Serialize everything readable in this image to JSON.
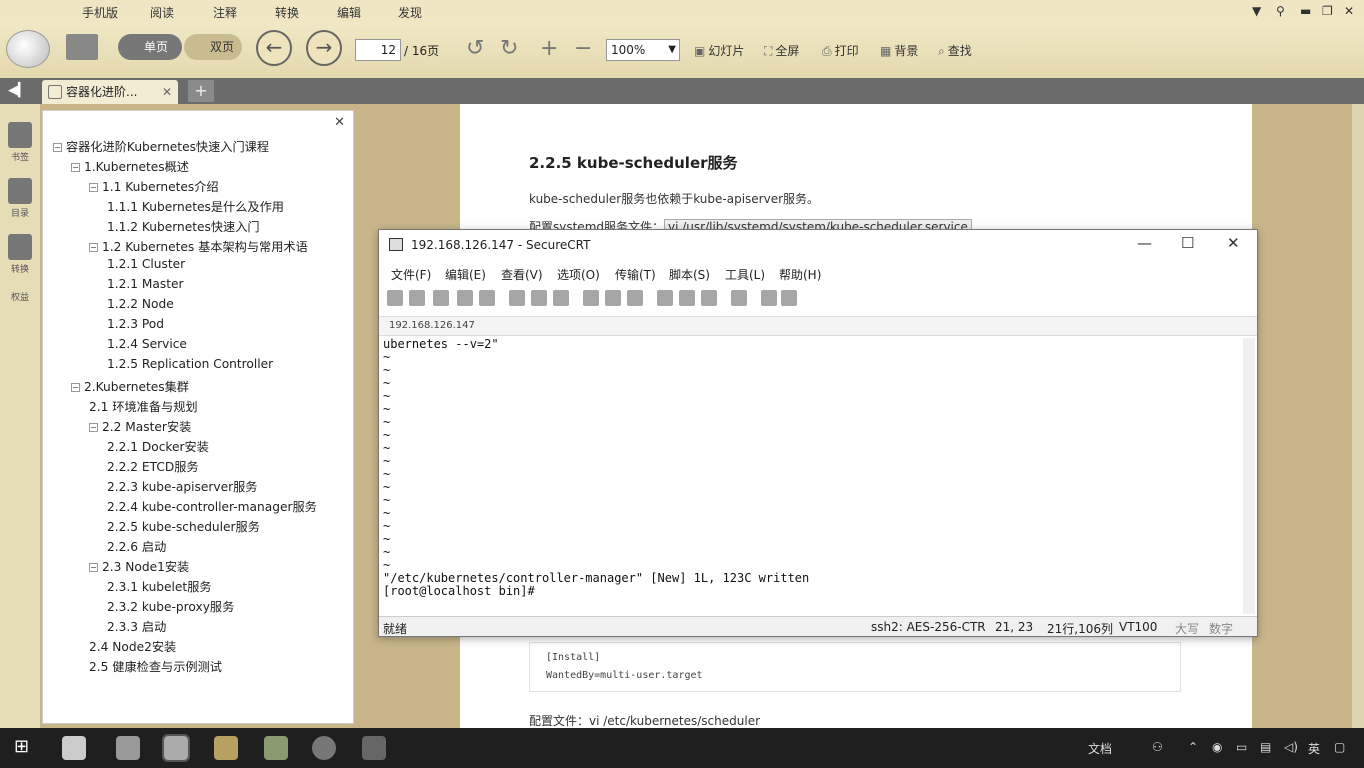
{
  "reader": {
    "menu": [
      "手机版",
      "阅读",
      "注释",
      "转换",
      "编辑",
      "发现"
    ],
    "view_single": "单页",
    "view_double": "双页",
    "page_current": "12",
    "page_total": "/ 16页",
    "zoom": "100%",
    "buttons": {
      "slideshow": "幻灯片",
      "fullscreen": "全屏",
      "print": "打印",
      "background": "背景",
      "find": "查找"
    },
    "tab_title": "容器化进阶...",
    "left_rail": {
      "bookmark": "书签",
      "toc": "目录",
      "convert": "转换",
      "more": "权益"
    }
  },
  "toc": [
    {
      "label": "容器化进阶Kubernetes快速入门课程",
      "level": 0,
      "toggle": "−"
    },
    {
      "label": "1.Kubernetes概述",
      "level": 1,
      "toggle": "−"
    },
    {
      "label": "1.1 Kubernetes介绍",
      "level": 2,
      "toggle": "−"
    },
    {
      "label": "1.1.1 Kubernetes是什么及作用",
      "level": 3,
      "toggle": ""
    },
    {
      "label": "1.1.2 Kubernetes快速入门",
      "level": 3,
      "toggle": ""
    },
    {
      "label": "1.2 Kubernetes 基本架构与常用术语",
      "level": 2,
      "toggle": "−"
    },
    {
      "label": "1.2.1 Cluster",
      "level": 3,
      "toggle": ""
    },
    {
      "label": "1.2.1 Master",
      "level": 3,
      "toggle": ""
    },
    {
      "label": "1.2.2 Node",
      "level": 3,
      "toggle": ""
    },
    {
      "label": "1.2.3 Pod",
      "level": 3,
      "toggle": ""
    },
    {
      "label": "1.2.4 Service",
      "level": 3,
      "toggle": ""
    },
    {
      "label": "1.2.5 Replication Controller",
      "level": 3,
      "toggle": ""
    },
    {
      "label": "2.Kubernetes集群",
      "level": 1,
      "toggle": "−"
    },
    {
      "label": "2.1 环境准备与规划",
      "level": 2,
      "toggle": ""
    },
    {
      "label": "2.2 Master安装",
      "level": 2,
      "toggle": "−"
    },
    {
      "label": "2.2.1 Docker安装",
      "level": 3,
      "toggle": ""
    },
    {
      "label": "2.2.2 ETCD服务",
      "level": 3,
      "toggle": ""
    },
    {
      "label": "2.2.3 kube-apiserver服务",
      "level": 3,
      "toggle": ""
    },
    {
      "label": "2.2.4 kube-controller-manager服务",
      "level": 3,
      "toggle": ""
    },
    {
      "label": "2.2.5 kube-scheduler服务",
      "level": 3,
      "toggle": ""
    },
    {
      "label": "2.2.6 启动",
      "level": 3,
      "toggle": ""
    },
    {
      "label": "2.3 Node1安装",
      "level": 2,
      "toggle": "−"
    },
    {
      "label": "2.3.1 kubelet服务",
      "level": 3,
      "toggle": ""
    },
    {
      "label": "2.3.2 kube-proxy服务",
      "level": 3,
      "toggle": ""
    },
    {
      "label": "2.3.3 启动",
      "level": 3,
      "toggle": ""
    },
    {
      "label": "2.4 Node2安装",
      "level": 2,
      "toggle": ""
    },
    {
      "label": "2.5 健康检查与示例测试",
      "level": 2,
      "toggle": ""
    }
  ],
  "document": {
    "heading": "2.2.5 kube-scheduler服务",
    "para1": "kube-scheduler服务也依赖于kube-apiserver服务。",
    "para2_prefix": "配置systemd服务文件：",
    "para2_code": "vi /usr/lib/systemd/system/kube-scheduler.service",
    "code_line1": "[Install]",
    "code_line2": "WantedBy=multi-user.target",
    "para3": "配置文件：vi /etc/kubernetes/scheduler"
  },
  "securecrt": {
    "title": "192.168.126.147 - SecureCRT",
    "menu": [
      "文件(F)",
      "编辑(E)",
      "查看(V)",
      "选项(O)",
      "传输(T)",
      "脚本(S)",
      "工具(L)",
      "帮助(H)"
    ],
    "session_tab": "192.168.126.147",
    "terminal": "ubernetes --v=2\"\n~\n~\n~\n~\n~\n~\n~\n~\n~\n~\n~\n~\n~\n~\n~\n~\n~\n\"/etc/kubernetes/controller-manager\" [New] 1L, 123C written\n[root@localhost bin]#",
    "status": {
      "ready": "就绪",
      "cipher": "ssh2: AES-256-CTR",
      "pos": "21,  23",
      "size": "21行,106列",
      "term": "VT100",
      "caps": "大写",
      "num": "数字"
    }
  },
  "taskbar": {
    "docs": "文档",
    "ime": "英"
  }
}
